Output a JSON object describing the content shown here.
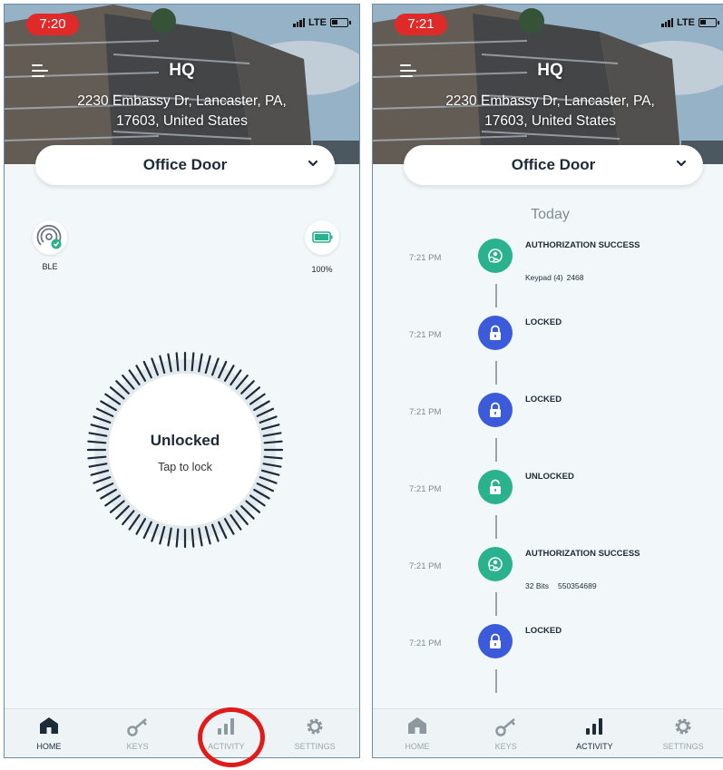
{
  "colors": {
    "green": "#2ab28e",
    "blue": "#3b5bdb",
    "dark": "#1c2a3a",
    "red_highlight": "#e11a1a"
  },
  "left": {
    "status_time": "7:20",
    "network": "LTE",
    "hero": {
      "title": "HQ",
      "address_line1": "2230 Embassy Dr, Lancaster, PA,",
      "address_line2": "17603, United States"
    },
    "door": "Office Door",
    "ble_label": "BLE",
    "battery_label": "100%",
    "lock_state": "Unlocked",
    "lock_hint": "Tap to lock",
    "nav": {
      "home": "HOME",
      "keys": "KEYS",
      "activity": "ACTIVITY",
      "settings": "SETTINGS"
    }
  },
  "right": {
    "status_time": "7:21",
    "network": "LTE",
    "hero": {
      "title": "HQ",
      "address_line1": "2230 Embassy Dr, Lancaster, PA,",
      "address_line2": "17603, United States"
    },
    "door": "Office Door",
    "section": "Today",
    "events": [
      {
        "time": "7:21 PM",
        "title": "AUTHORIZATION SUCCESS",
        "detail_a": "Keypad (4)",
        "detail_b": "2468",
        "kind": "auth"
      },
      {
        "time": "7:21 PM",
        "title": "LOCKED",
        "kind": "locked"
      },
      {
        "time": "7:21 PM",
        "title": "LOCKED",
        "kind": "locked"
      },
      {
        "time": "7:21 PM",
        "title": "UNLOCKED",
        "kind": "unlocked"
      },
      {
        "time": "7:21 PM",
        "title": "AUTHORIZATION SUCCESS",
        "detail_a": "32 Bits",
        "detail_b": "550354689",
        "kind": "auth"
      },
      {
        "time": "7:21 PM",
        "title": "LOCKED",
        "kind": "locked"
      }
    ],
    "nav": {
      "home": "HOME",
      "keys": "KEYS",
      "activity": "ACTIVITY",
      "settings": "SETTINGS"
    }
  }
}
